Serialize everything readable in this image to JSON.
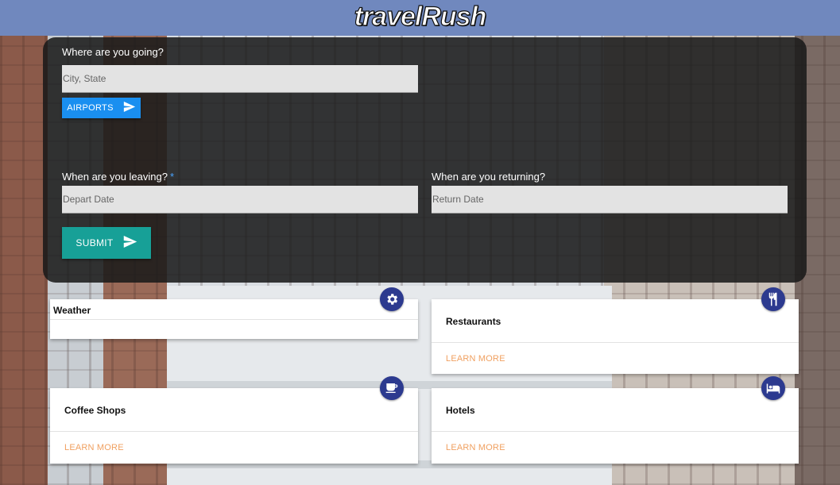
{
  "header": {
    "brand": "travelRush"
  },
  "search": {
    "destination_label": "Where are you going?",
    "destination_placeholder": "City, State",
    "airports_button": "AIRPORTS",
    "leaving_label": "When are you leaving?",
    "leaving_required": "*",
    "depart_placeholder": "Depart Date",
    "returning_label": "When are you returning?",
    "return_placeholder": "Return Date",
    "submit_button": "SUBMIT"
  },
  "cards": {
    "weather": {
      "title": "Weather",
      "icon": "gear-icon"
    },
    "restaurants": {
      "title": "Restaurants",
      "link": "LEARN MORE",
      "icon": "restaurant-icon"
    },
    "coffee": {
      "title": "Coffee Shops",
      "link": "LEARN MORE",
      "icon": "coffee-cup-icon"
    },
    "hotels": {
      "title": "Hotels",
      "link": "LEARN MORE",
      "icon": "bed-icon"
    }
  },
  "colors": {
    "header": "#7088be",
    "airports_button": "#1a8ff0",
    "submit_button": "#17a097",
    "badge": "#2c3a8f",
    "link": "#f0a060"
  }
}
